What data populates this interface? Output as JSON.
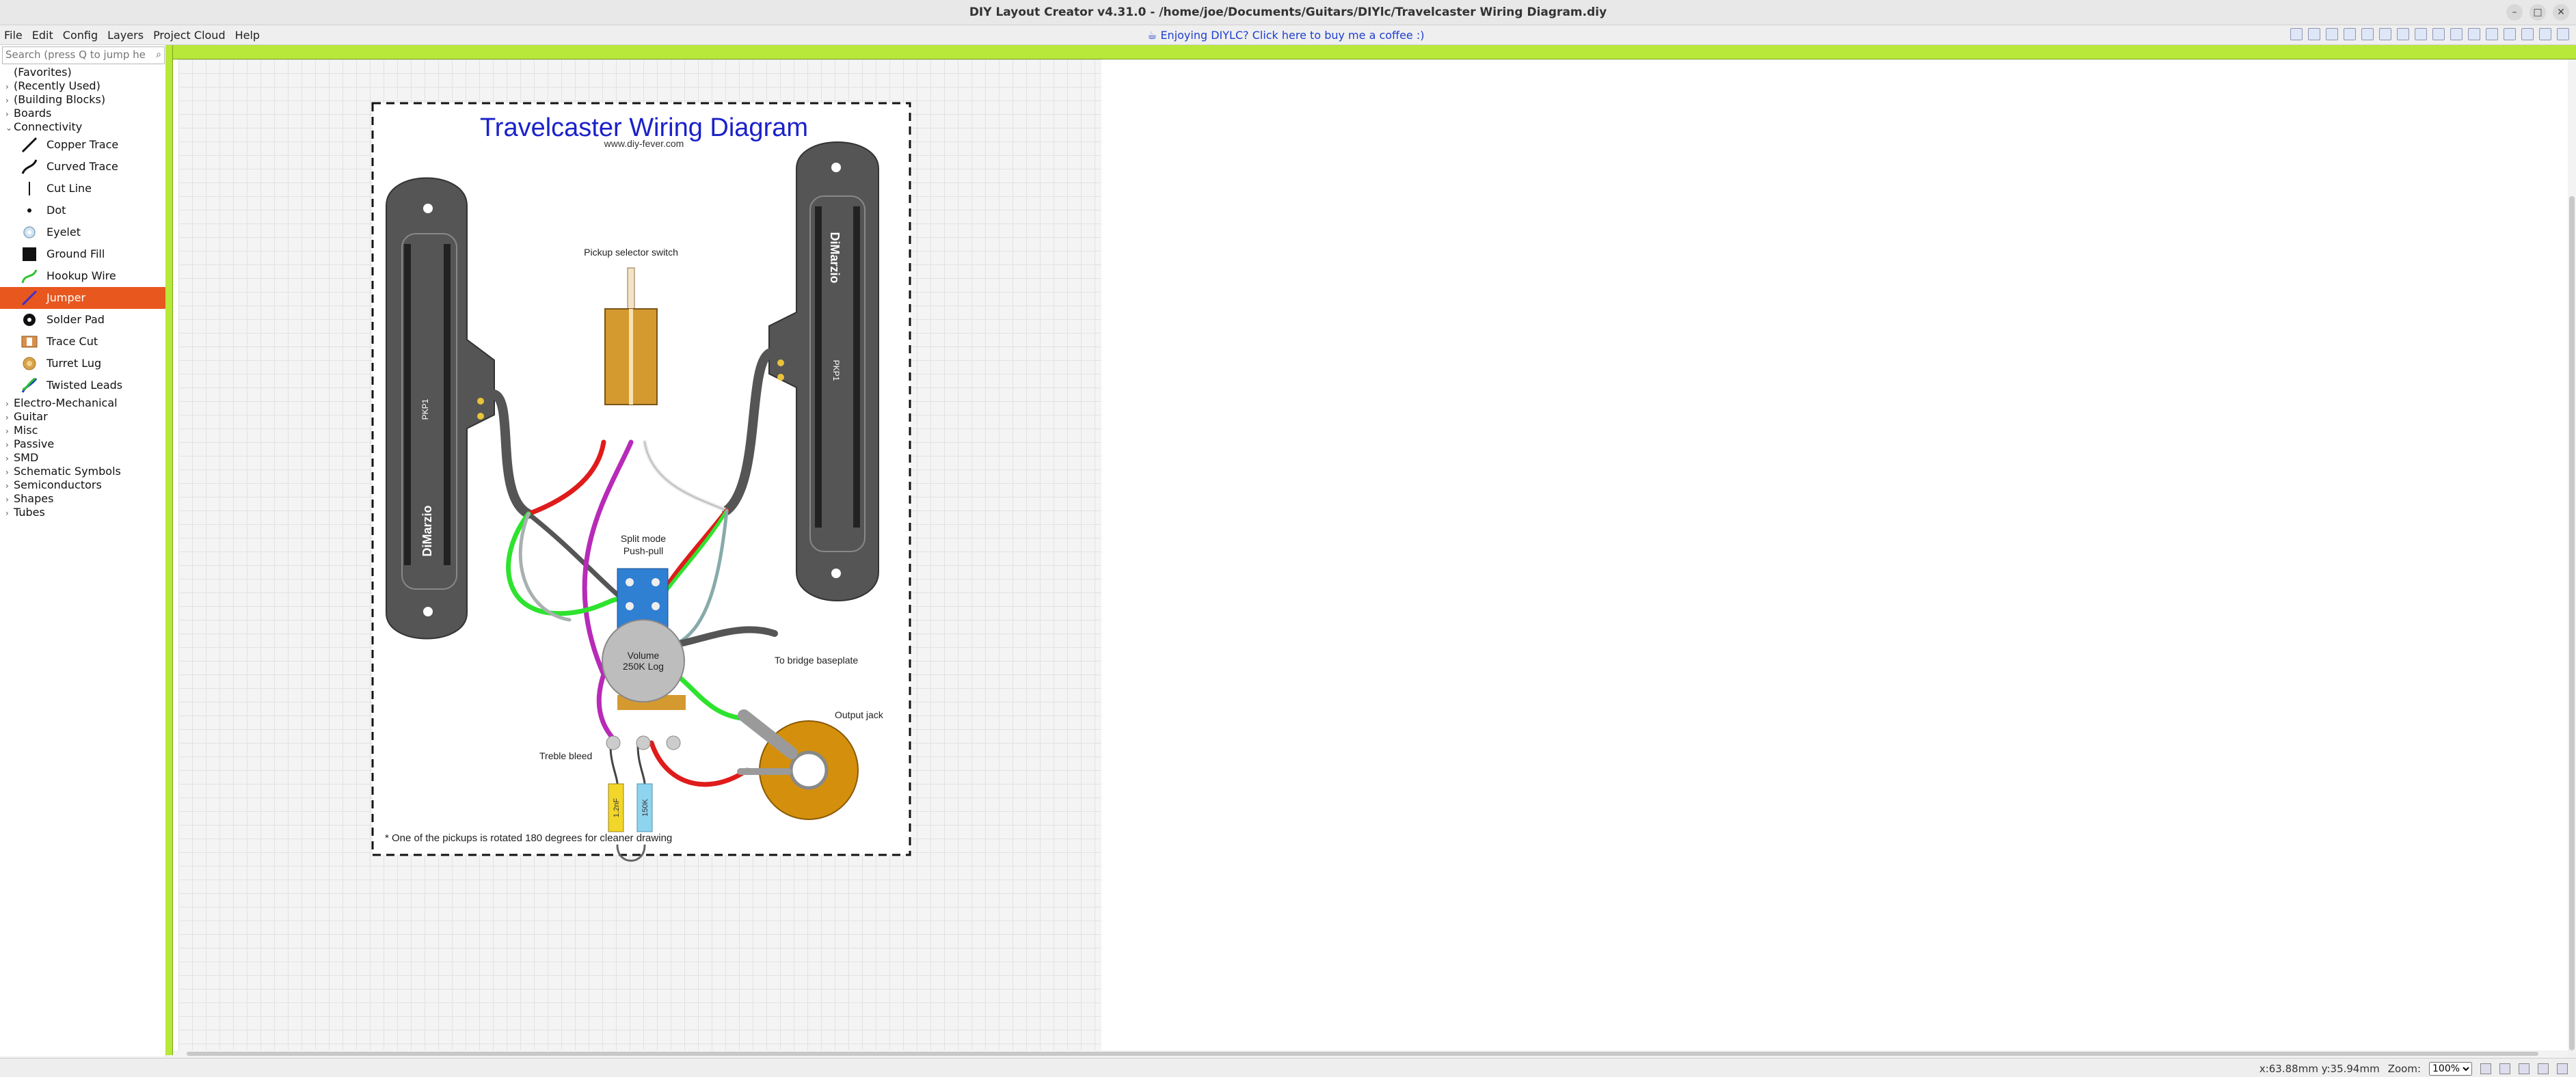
{
  "window": {
    "title": "DIY Layout Creator v4.31.0 - /home/joe/Documents/Guitars/DIYlc/Travelcaster Wiring Diagram.diy"
  },
  "menu": [
    "File",
    "Edit",
    "Config",
    "Layers",
    "Project Cloud",
    "Help"
  ],
  "promo": "Enjoying DIYLC? Click here to buy me a coffee :)",
  "search": {
    "placeholder": "Search (press Q to jump here)"
  },
  "tree_top": [
    {
      "label": "(Favorites)",
      "arrow": ""
    },
    {
      "label": "(Recently Used)",
      "arrow": "›"
    },
    {
      "label": "(Building Blocks)",
      "arrow": "›"
    },
    {
      "label": "Boards",
      "arrow": "›"
    },
    {
      "label": "Connectivity",
      "arrow": "⌄"
    }
  ],
  "connectivity_items": [
    "Copper Trace",
    "Curved Trace",
    "Cut Line",
    "Dot",
    "Eyelet",
    "Ground Fill",
    "Hookup Wire",
    "Jumper",
    "Solder Pad",
    "Trace Cut",
    "Turret Lug",
    "Twisted Leads"
  ],
  "tree_bottom": [
    "Electro-Mechanical",
    "Guitar",
    "Misc",
    "Passive",
    "SMD",
    "Schematic Symbols",
    "Semiconductors",
    "Shapes",
    "Tubes"
  ],
  "diagram": {
    "title": "Travelcaster Wiring Diagram",
    "subtitle": "www.diy-fever.com",
    "switch_label": "Pickup selector switch",
    "split_label_1": "Split mode",
    "split_label_2": "Push-pull",
    "vol_label_1": "Volume",
    "vol_label_2": "250K Log",
    "bridge_label": "To bridge baseplate",
    "jack_label": "Output jack",
    "treble_label": "Treble bleed",
    "cap_value": "1.2nF",
    "res_value": "150K",
    "footnote": "* One of the pickups is rotated 180 degrees for cleaner drawing",
    "pickup_brand": "DiMarzio",
    "pickup_code": "PKP1"
  },
  "status": {
    "coords": "x:63.88mm y:35.94mm",
    "zoom_label": "Zoom:",
    "zoom_value": "100%"
  }
}
